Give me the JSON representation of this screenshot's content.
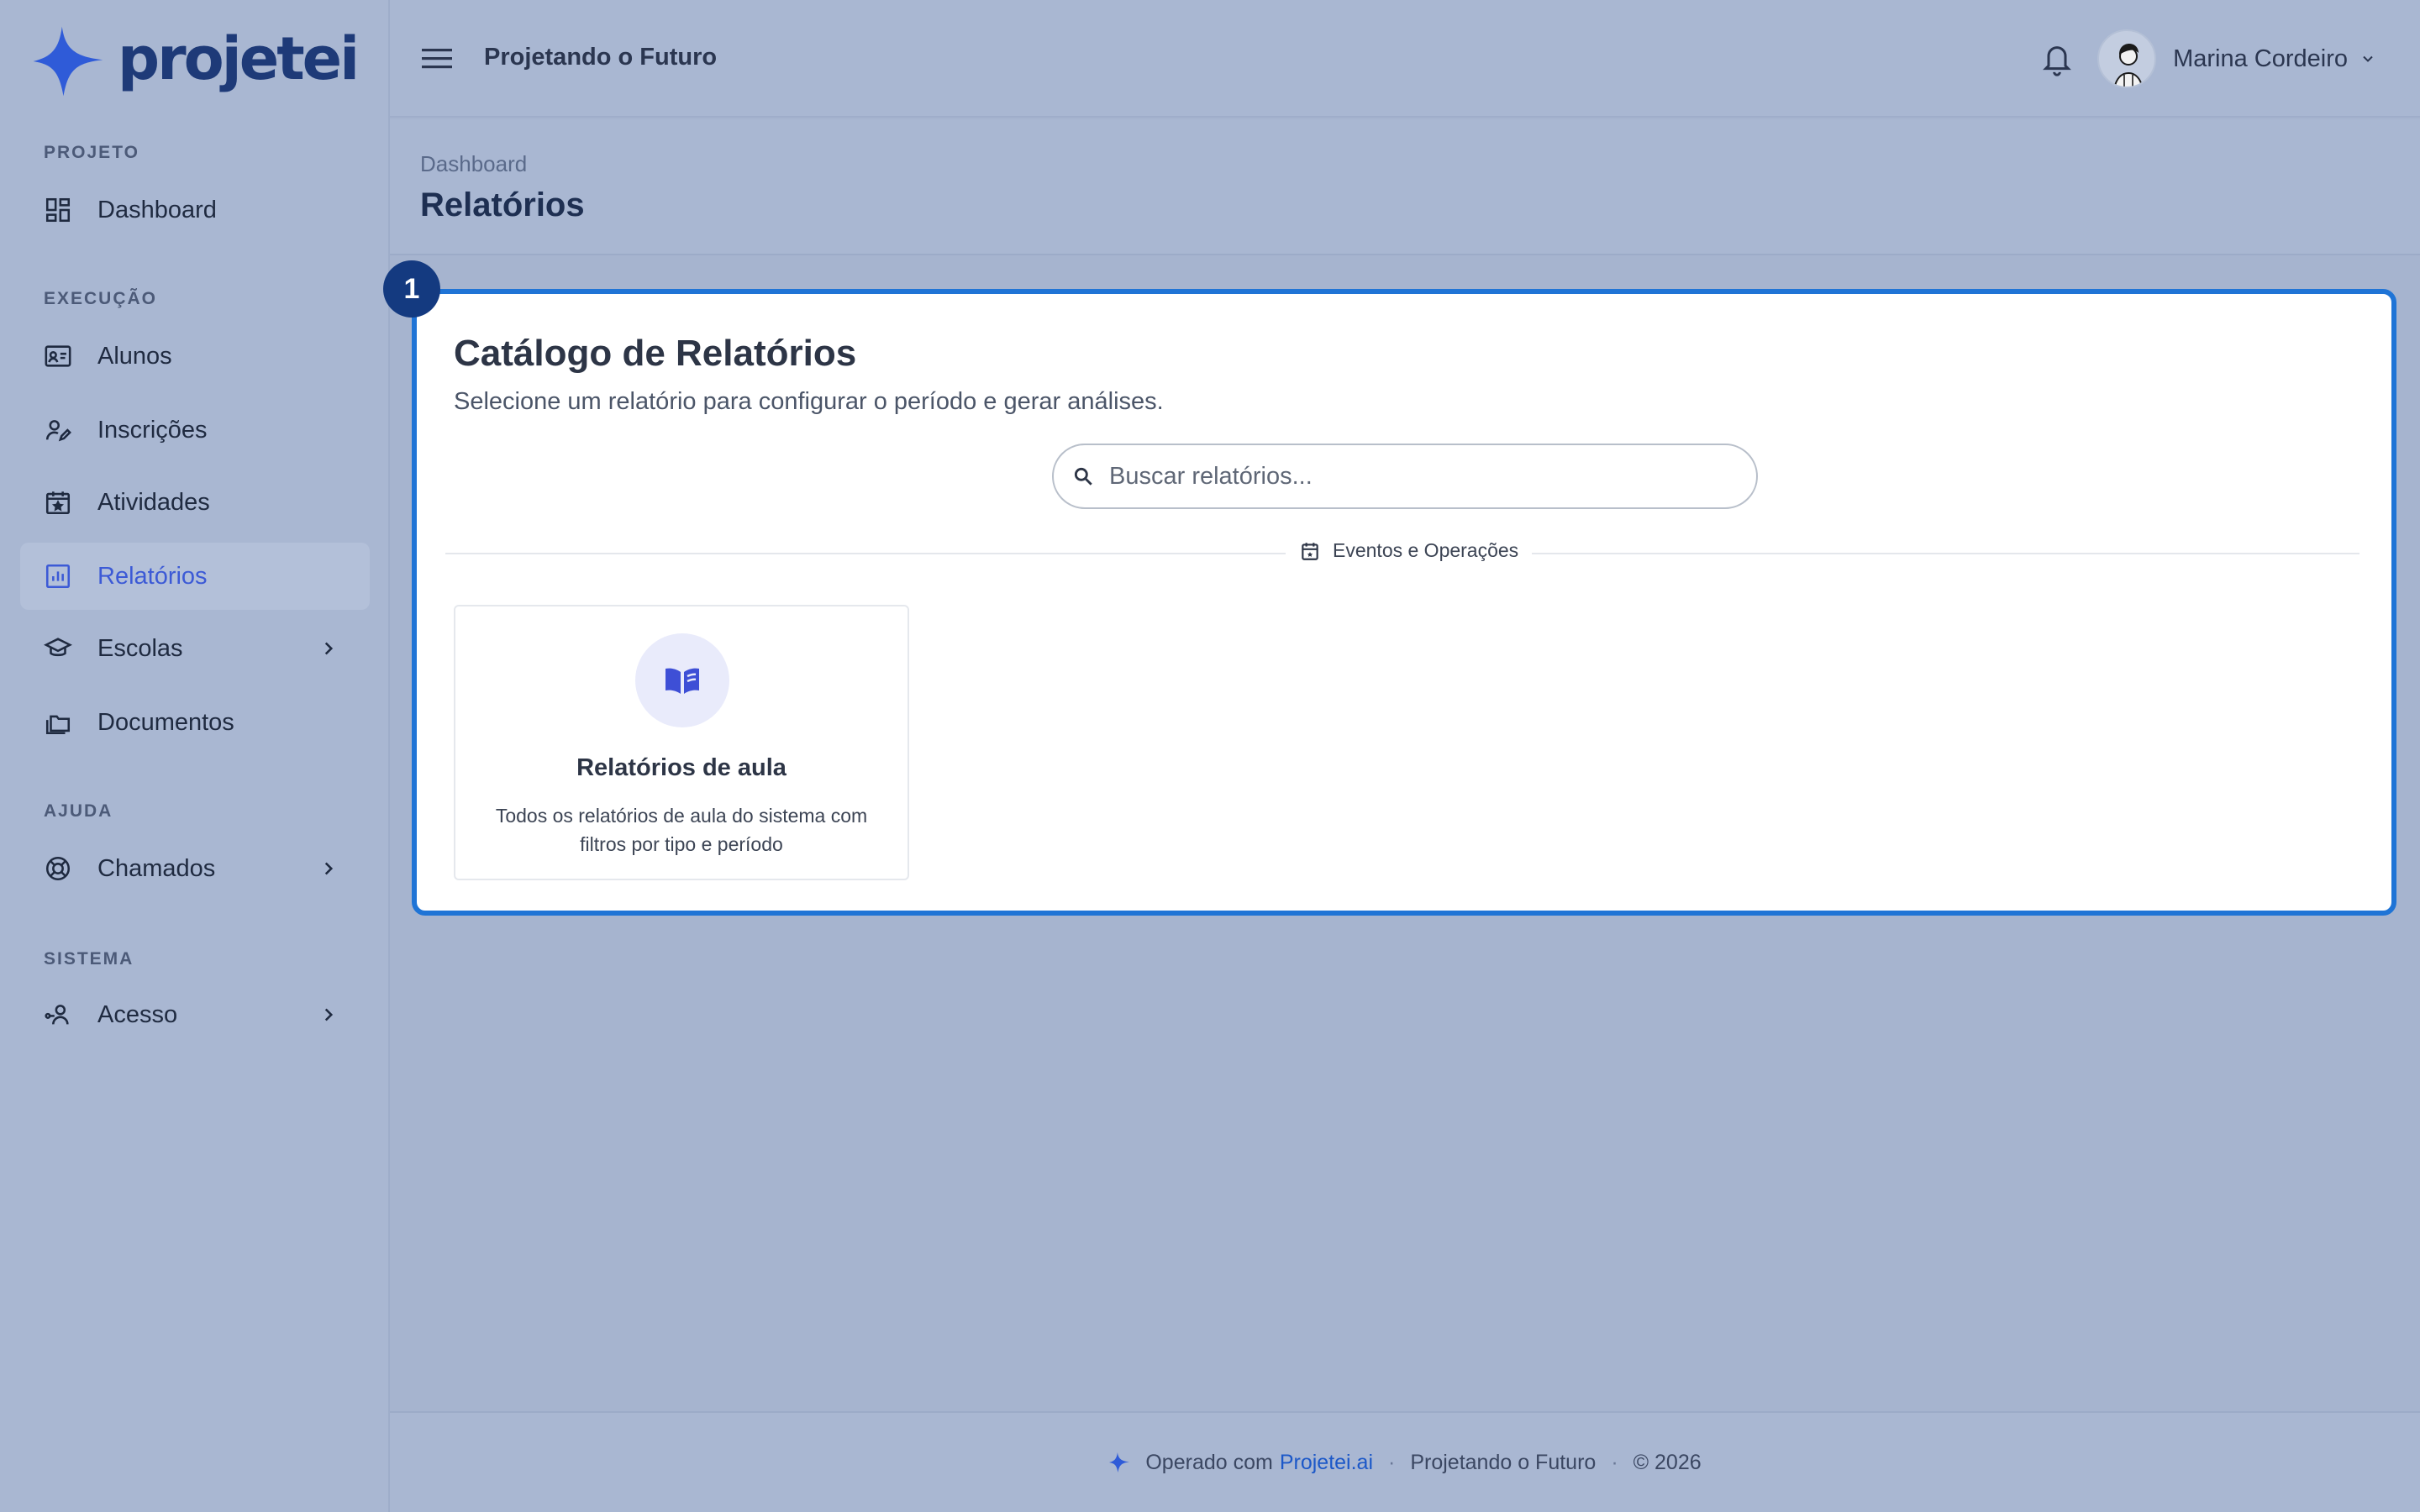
{
  "brand": {
    "name": "projetei",
    "accent": "#2f5bd8",
    "dark": "#1e3a78"
  },
  "sidebar": {
    "sections": {
      "projeto": "PROJETO",
      "execucao": "EXECUÇÃO",
      "ajuda": "AJUDA",
      "sistema": "SISTEMA"
    },
    "items": {
      "dashboard": "Dashboard",
      "alunos": "Alunos",
      "inscricoes": "Inscrições",
      "atividades": "Atividades",
      "relatorios": "Relatórios",
      "escolas": "Escolas",
      "documentos": "Documentos",
      "chamados": "Chamados",
      "acesso": "Acesso"
    },
    "active": "relatorios"
  },
  "header": {
    "org": "Projetando o Futuro",
    "user_name": "Marina Cordeiro"
  },
  "page": {
    "breadcrumb": "Dashboard",
    "title": "Relatórios"
  },
  "catalog": {
    "step": "1",
    "title": "Catálogo de Relatórios",
    "subtitle": "Selecione um relatório para configurar o período e gerar análises.",
    "search_placeholder": "Buscar relatórios...",
    "search_value": "",
    "group_label": "Eventos e Operações",
    "reports": [
      {
        "title": "Relatórios de aula",
        "description": "Todos os relatórios de aula do sistema com filtros por tipo e período",
        "icon": "book-open-icon"
      }
    ]
  },
  "footer": {
    "prefix": "Operado com",
    "link": "Projetei.ai",
    "org": "Projetando o Futuro",
    "copyright": "© 2026"
  }
}
